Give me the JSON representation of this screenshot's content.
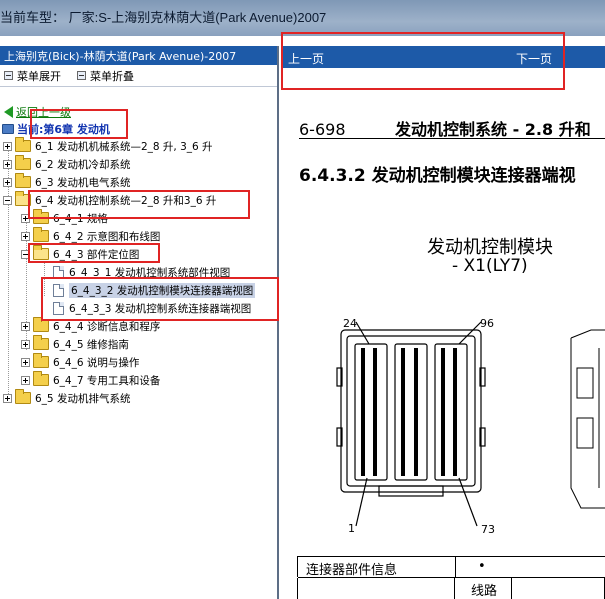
{
  "topbar": {
    "title": "当前车型：  厂家:S-上海别克林荫大道(Park Avenue)2007"
  },
  "left": {
    "header": "上海别克(Bick)-林荫大道(Park Avenue)-2007",
    "expand_label": "菜单展开",
    "collapse_label": "菜单折叠",
    "back_label": "返回上一级",
    "current_label": "当前:第6章 发动机",
    "tree": [
      {
        "id": "n1",
        "label": "6_1 发动机机械系统—2_8 升, 3_6 升"
      },
      {
        "id": "n2",
        "label": "6_2 发动机冷却系统"
      },
      {
        "id": "n3",
        "label": "6_3 发动机电气系统"
      },
      {
        "id": "n4",
        "label": "6_4 发动机控制系统—2_8 升和3_6 升"
      },
      {
        "id": "n5",
        "label": "6_4_1 规格"
      },
      {
        "id": "n6",
        "label": "6_4_2 示意图和布线图"
      },
      {
        "id": "n7",
        "label": "6_4_3 部件定位图"
      },
      {
        "id": "n8",
        "label": "6_4_3_1 发动机控制系统部件视图"
      },
      {
        "id": "n9",
        "label": "6_4_3_2 发动机控制模块连接器端视图"
      },
      {
        "id": "n10",
        "label": "6_4_3_3 发动机控制系统连接器端视图"
      },
      {
        "id": "n11",
        "label": "6_4_4 诊断信息和程序"
      },
      {
        "id": "n12",
        "label": "6_4_5 维修指南"
      },
      {
        "id": "n13",
        "label": "6_4_6 说明与操作"
      },
      {
        "id": "n14",
        "label": "6_4_7 专用工具和设备"
      },
      {
        "id": "n15",
        "label": "6_5 发动机排气系统"
      }
    ]
  },
  "right": {
    "prev_label": "上一页",
    "next_label": "下一页",
    "section_number": "6-698",
    "section_title": "发动机控制系统 - 2.8 升和",
    "subsection": "6.4.3.2 发动机控制模块连接器端视",
    "connector_title": "发动机控制模块",
    "connector_sub": "- X1(LY7)",
    "pins": {
      "top_left": "24",
      "top_right": "96",
      "bottom_left": "1",
      "bottom_right": "73"
    },
    "table": {
      "info_label": "连接器部件信息",
      "bullet": "•",
      "row2_label": "线路"
    }
  }
}
